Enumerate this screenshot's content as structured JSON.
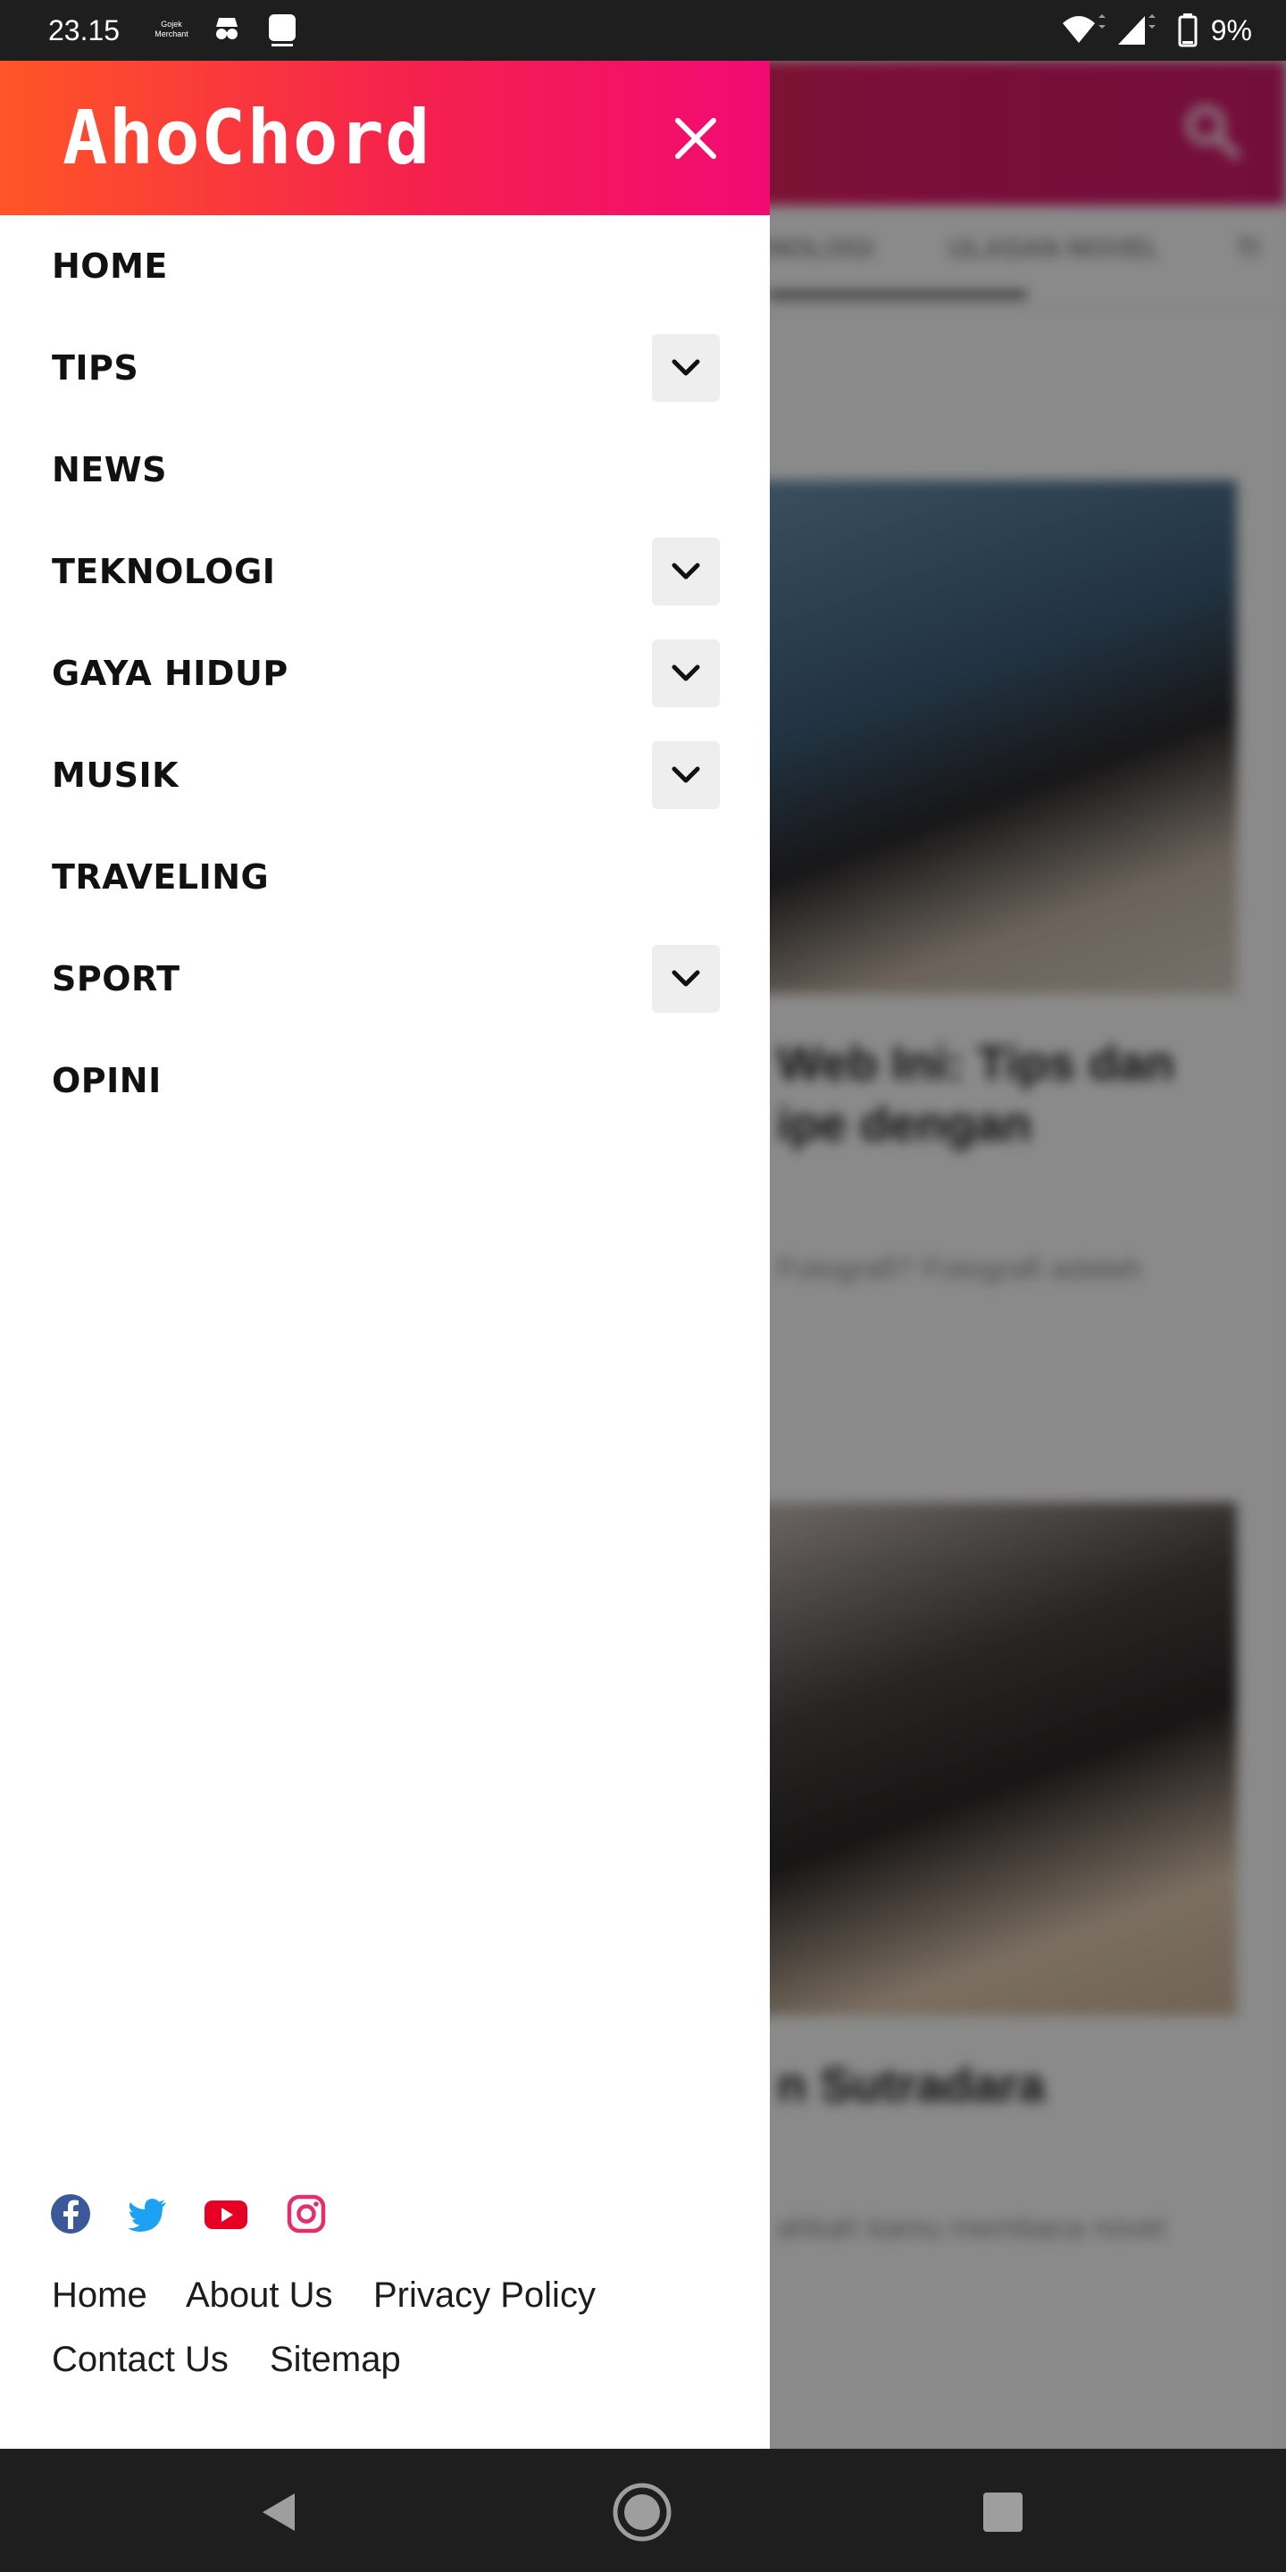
{
  "status_bar": {
    "time": "23.15",
    "notification_icons": [
      "gojek-merchant-icon",
      "incognito-icon",
      "app-icon"
    ],
    "battery": "9%"
  },
  "background_page": {
    "tabs": [
      "TEKNOLOGI",
      "ULASAN NOVEL",
      "TI"
    ],
    "articles": [
      {
        "title_lines": [
          "Web Ini: Tips dan",
          "ipe dengan"
        ],
        "excerpt": "Fotografi? Fotografi adalah"
      },
      {
        "title_lines": [
          "n Sutradara"
        ],
        "excerpt": "ahkah kamu membaca novel"
      }
    ]
  },
  "drawer": {
    "logo": "AhoChord",
    "menu": [
      {
        "label": "HOME",
        "expandable": false
      },
      {
        "label": "TIPS",
        "expandable": true
      },
      {
        "label": "NEWS",
        "expandable": false
      },
      {
        "label": "TEKNOLOGI",
        "expandable": true
      },
      {
        "label": "GAYA HIDUP",
        "expandable": true
      },
      {
        "label": "MUSIK",
        "expandable": true
      },
      {
        "label": "TRAVELING",
        "expandable": false
      },
      {
        "label": "SPORT",
        "expandable": true
      },
      {
        "label": "OPINI",
        "expandable": false
      }
    ],
    "social": [
      "facebook-icon",
      "twitter-icon",
      "youtube-icon",
      "instagram-icon"
    ],
    "footer_links": [
      "Home",
      "About Us",
      "Privacy Policy",
      "Contact Us",
      "Sitemap"
    ]
  },
  "colors": {
    "brand_gradient_start": "#ff5527",
    "brand_gradient_end": "#f20a73",
    "facebook": "#3b5998",
    "twitter": "#1da1f2",
    "youtube": "#e60023",
    "instagram": "#e1306c"
  }
}
